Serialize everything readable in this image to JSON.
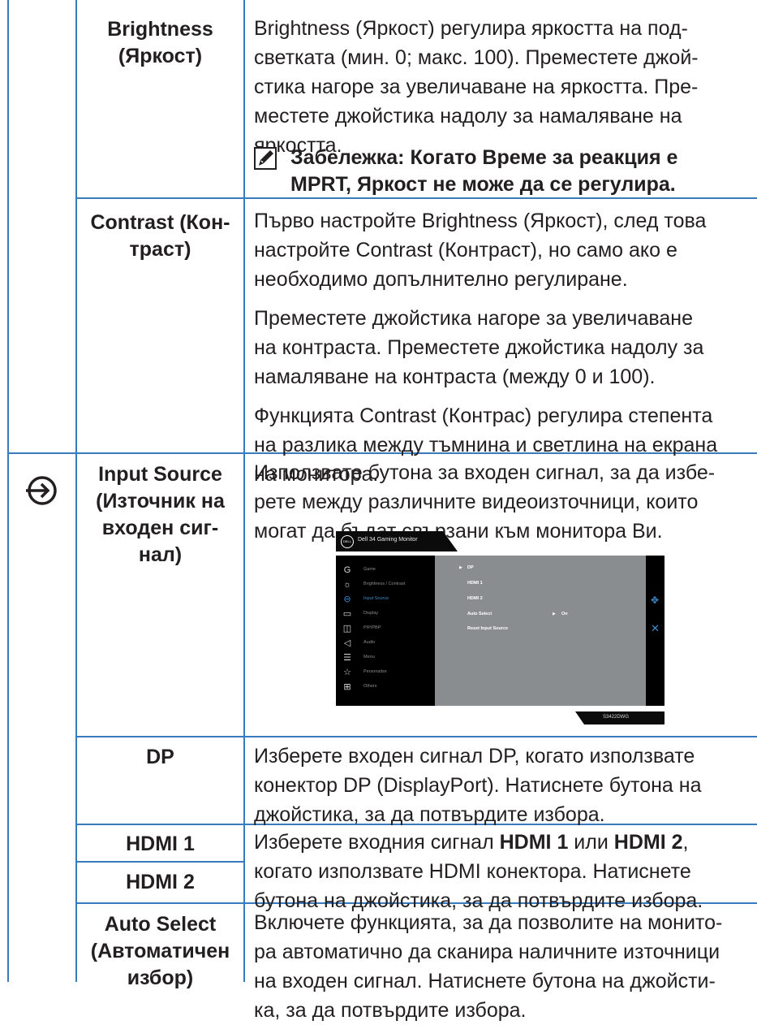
{
  "rows": {
    "brightness": {
      "label": "Brightness (Яркост)",
      "label_line1": "Brightness",
      "label_line2": "(Яркост)",
      "description_lines": [
        "Brightness (Яркост) регулира яркостта на под-",
        "светката (мин. 0; макс. 100). Преместете джой-",
        "стика нагоре за увеличаване на яркостта. Пре-",
        "местете джойстика надолу за намаляване на",
        "яркостта."
      ],
      "note_lines": [
        "Забележка: Когато Време за реакция е",
        "MPRT, Яркост не може да се регулира."
      ],
      "note_icon": "pencil-note-icon"
    },
    "contrast": {
      "label_line1": "Contrast (Кон-",
      "label_line2": "траст)",
      "paragraph1_lines": [
        "Първо настройте Brightness (Яркост), след това",
        "настройте Contrast (Контраст), но само ако е",
        "необходимо допълнително регулиране."
      ],
      "paragraph2_lines": [
        "Преместете джойстика нагоре за увеличаване",
        "на контраста. Преместете джойстика надолу за",
        "намаляване на контраста (между 0 и 100)."
      ],
      "paragraph3_lines": [
        "Функцията Contrast (Контрас) регулира степента",
        "на разлика между тъмнина и светлина на екрана",
        "на монитора."
      ]
    },
    "input_source": {
      "icon": "input-source-icon",
      "label_lines": [
        "Input Source",
        "(Източник на",
        "входен сиг-",
        "нал)"
      ],
      "description_lines": [
        "Използвате бутона за входен сигнал, за да избе-",
        "рете между различните видеоизточници, които",
        "могат да бъдат свързани към монитора Ви."
      ]
    },
    "dp": {
      "label": "DP",
      "description_lines": [
        "Изберете входен сигнал DP, когато използвате",
        "конектор DP (DisplayPort). Натиснете бутона на",
        "джойстика, за да потвърдите избора."
      ]
    },
    "hdmi": {
      "label1": "HDMI 1",
      "label2": "HDMI 2",
      "line1_prefix": "Изберете входния сигнал ",
      "line1_bold1": "HDMI 1",
      "line1_mid": " или ",
      "line1_bold2": "HDMI 2",
      "line1_suffix": ",",
      "line2": "когато използвате HDMI конектора. Натиснете",
      "line3": "бутона на джойстика, за да потвърдите избора."
    },
    "auto_select": {
      "label_lines": [
        "Auto Select",
        "(Автоматичен",
        "избор)"
      ],
      "description_lines": [
        "Включете функцията, за да позволите на монито-",
        "ра автоматично да сканира наличните източници",
        "на входен сигнал. Натиснете бутона на джойсти-",
        "ка, за да потвърдите избора."
      ]
    }
  },
  "osd": {
    "brand_logo": "DELL",
    "title": "Dell 34 Gaming Monitor",
    "menu_items": [
      {
        "icon": "game-icon",
        "glyph": "G",
        "label": "Game",
        "active": false
      },
      {
        "icon": "brightness-contrast-icon",
        "glyph": "☼",
        "label": "Brightness / Contrast",
        "active": false
      },
      {
        "icon": "input-source-icon",
        "glyph": "⊖",
        "label": "Input Source",
        "active": true
      },
      {
        "icon": "display-icon",
        "glyph": "▭",
        "label": "Display",
        "active": false
      },
      {
        "icon": "pip-pbp-icon",
        "glyph": "◫",
        "label": "PIP/PBP",
        "active": false
      },
      {
        "icon": "audio-icon",
        "glyph": "◁",
        "label": "Audio",
        "active": false
      },
      {
        "icon": "menu-icon",
        "glyph": "☰",
        "label": "Menu",
        "active": false
      },
      {
        "icon": "personalize-icon",
        "glyph": "☆",
        "label": "Personalize",
        "active": false
      },
      {
        "icon": "others-icon",
        "glyph": "⊞",
        "label": "Others",
        "active": false
      }
    ],
    "options": [
      {
        "label": "DP",
        "selected": true,
        "value": ""
      },
      {
        "label": "HDMI 1",
        "selected": false,
        "value": ""
      },
      {
        "label": "HDMI 2",
        "selected": false,
        "value": ""
      },
      {
        "label": "Auto Select",
        "selected": false,
        "value": "On"
      },
      {
        "label": "Reset Input Source",
        "selected": false,
        "value": ""
      }
    ],
    "side_icons": [
      "joystick-move-icon",
      "close-icon"
    ],
    "model": "S3422DWG",
    "accent_color": "#3e8ed0"
  },
  "colors": {
    "rule": "#3a7bbf",
    "text": "#231f20"
  }
}
